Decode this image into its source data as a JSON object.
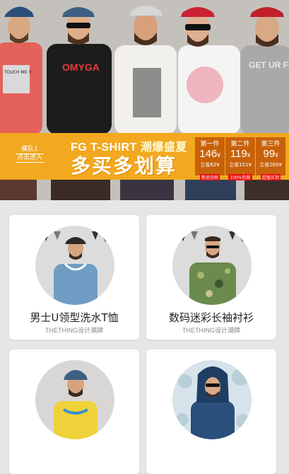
{
  "hero": {
    "models_print": [
      "TOUCH ME !!",
      "OMYGA",
      "GET UR FREAK ON"
    ],
    "left_label_1": "横队1",
    "left_label_2": "点击进入",
    "title_en": "FG T-SHIRT",
    "title_cn": "潮爆盛夏",
    "slogan": "多买多划算",
    "deals": [
      {
        "label": "第一件",
        "price": "146",
        "currency": "¥",
        "save": "立省62¥",
        "tag": "新品包邮"
      },
      {
        "label": "第二件",
        "price": "119",
        "currency": "¥",
        "save": "立省151¥",
        "tag": "100%包邮"
      },
      {
        "label": "第三件",
        "price": "99",
        "currency": "¥",
        "save": "立省260¥",
        "tag": "超值买到"
      }
    ]
  },
  "products": [
    {
      "name": "男士U领型洗水T恤",
      "brand": "THETHING设计潮牌"
    },
    {
      "name": "数码迷彩长袖衬衫",
      "brand": "THETHING设计潮牌"
    },
    {
      "name": "",
      "brand": ""
    },
    {
      "name": "",
      "brand": ""
    }
  ],
  "colors": {
    "banner": "#f2a81f",
    "deal_bg": "#c8620a",
    "page_bg": "#e6e6e6"
  }
}
